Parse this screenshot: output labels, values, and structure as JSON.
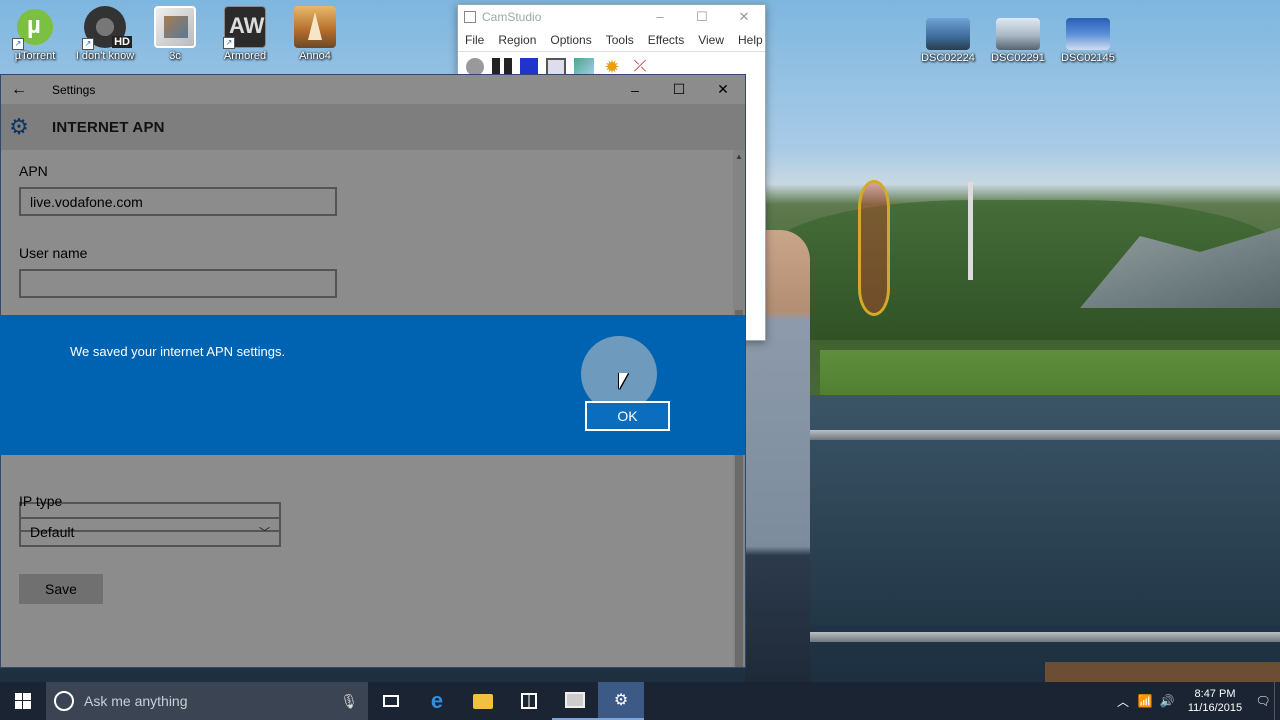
{
  "desktop": {
    "icons": [
      {
        "label": "µTorrent",
        "icon": "utorrent-icon"
      },
      {
        "label": "I don't know",
        "icon": "video-hd-icon"
      },
      {
        "label": "3c",
        "icon": "image-file-icon"
      },
      {
        "label": "Armored",
        "icon": "armored-warfare-icon"
      },
      {
        "label": "Anno4",
        "icon": "anno-game-icon"
      },
      {
        "label": "DSC02224",
        "icon": "photo-thumbnail-icon"
      },
      {
        "label": "DSC02291",
        "icon": "photo-thumbnail-icon"
      },
      {
        "label": "DSC02145",
        "icon": "photo-thumbnail-icon"
      }
    ]
  },
  "camstudio": {
    "title": "CamStudio",
    "menu": [
      "File",
      "Region",
      "Options",
      "Tools",
      "Effects",
      "View",
      "Help"
    ],
    "toolbar_icons": [
      "record-icon",
      "pause-icon",
      "stop-icon",
      "region-icon",
      "annotate-icon",
      "effects-icon",
      "options-icon"
    ]
  },
  "settings": {
    "window_title": "Settings",
    "page_title": "INTERNET APN",
    "apn": {
      "label": "APN",
      "value": "live.vodafone.com"
    },
    "username": {
      "label": "User name",
      "value": ""
    },
    "ip_type": {
      "label": "IP type",
      "selected": "Default"
    },
    "save_label": "Save"
  },
  "dialog": {
    "message": "We saved your internet APN settings.",
    "ok_label": "OK",
    "accent_color": "#0063b1"
  },
  "taskbar": {
    "search_placeholder": "Ask me anything",
    "time": "8:47 PM",
    "date": "11/16/2015"
  }
}
